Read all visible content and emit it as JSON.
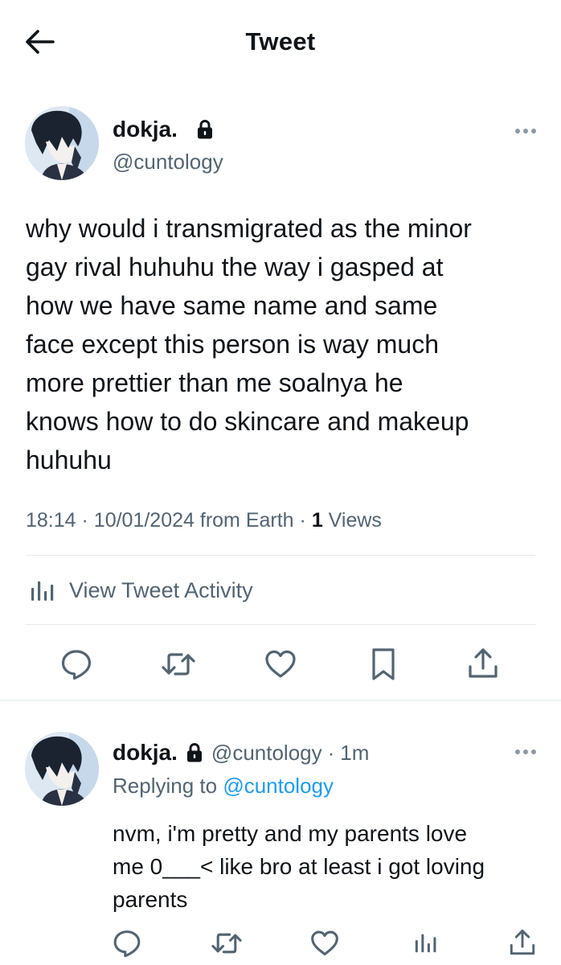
{
  "header": {
    "title": "Tweet",
    "back_icon": "arrow-left-icon"
  },
  "main_tweet": {
    "display_name": "dokja.",
    "handle": "@cuntology",
    "protected_icon": "lock-icon",
    "text": "why would i transmigrated as the minor\ngay rival huhuhu the way i gasped at\nhow we have same name and same\nface except this person is way much\nmore prettier than me soalnya he\nknows how to do skincare and makeup\nhuhuhu",
    "time": "18:14",
    "date": "10/01/2024",
    "source": "from Earth",
    "views_count": "1",
    "views_label": "Views",
    "activity_label": "View Tweet Activity",
    "actions": [
      "reply-icon",
      "retweet-icon",
      "like-icon",
      "bookmark-icon",
      "share-icon"
    ]
  },
  "reply_tweet": {
    "display_name": "dokja.",
    "handle": "@cuntology",
    "separator": "·",
    "time": "1m",
    "replying_prefix": "Replying to",
    "replying_to": "@cuntology",
    "text": "nvm, i'm pretty and my parents love\nme 0___< like bro at least i got loving\nparents",
    "actions": [
      "reply-icon",
      "retweet-icon",
      "like-icon",
      "views-icon",
      "share-icon"
    ]
  },
  "colors": {
    "text": "#0f1419",
    "secondary": "#536471",
    "link": "#1d9bf0",
    "divider": "#e6e9eb"
  }
}
